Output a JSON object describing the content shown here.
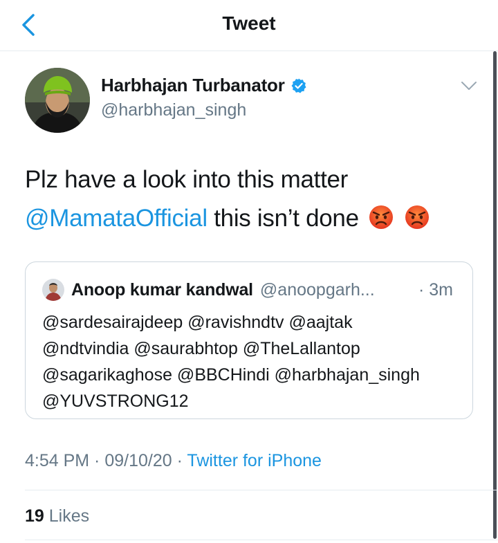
{
  "nav": {
    "title": "Tweet",
    "back_icon": "chevron-left-icon"
  },
  "author": {
    "name": "Harbhajan Turbanator",
    "handle": "@harbhajan_singh",
    "verified_icon": "verified-badge-icon"
  },
  "tweet": {
    "line1": "Plz have a look into this matter",
    "mention": "@MamataOfficial",
    "line2_rest": "this isn’t done",
    "emoji_icon": "angry-face-emoji"
  },
  "quote": {
    "name": "Anoop kumar kandwal",
    "handle": "@anoopgarh...",
    "time": "· 3m",
    "lines": [
      "@sardesairajdeep @ravishndtv @aajtak",
      "@ndtvindia @saurabhtop @TheLallantop",
      "@sagarikaghose @BBCHindi @harbhajan_singh",
      "@YUVSTRONG12"
    ]
  },
  "meta": {
    "time": "4:54 PM",
    "separator": " · ",
    "date": "09/10/20",
    "source": "Twitter for iPhone"
  },
  "stats": {
    "likes_count": "19",
    "likes_label": "Likes"
  },
  "colors": {
    "link": "#1b95e0",
    "text": "#14171a",
    "secondary": "#657786",
    "divider": "#e6ecf0"
  }
}
